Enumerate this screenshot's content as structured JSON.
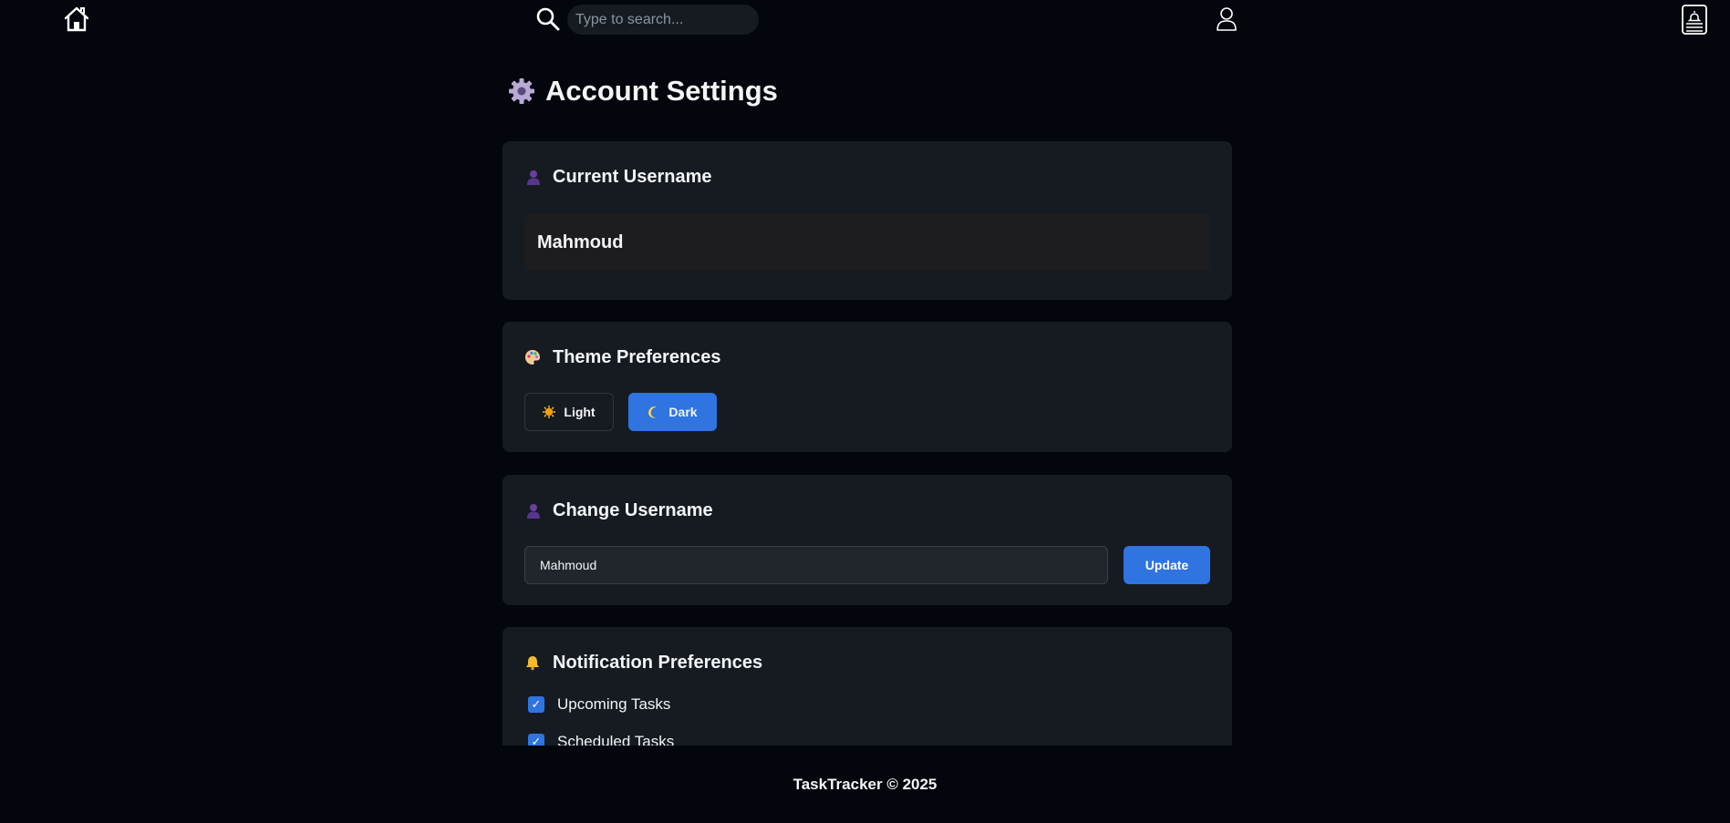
{
  "nav": {
    "search_placeholder": "Type to search..."
  },
  "page": {
    "title": "Account Settings"
  },
  "current_username": {
    "title": "Current Username",
    "value": "Mahmoud"
  },
  "theme": {
    "title": "Theme Preferences",
    "options": [
      {
        "label": "Light",
        "icon": "sun-icon",
        "selected": false
      },
      {
        "label": "Dark",
        "icon": "moon-icon",
        "selected": true
      }
    ]
  },
  "change_username": {
    "title": "Change Username",
    "input_value": "Mahmoud",
    "button_label": "Update"
  },
  "notifications": {
    "title": "Notification Preferences",
    "items": [
      {
        "label": "Upcoming Tasks",
        "checked": true
      },
      {
        "label": "Scheduled Tasks",
        "checked": true
      }
    ]
  },
  "footer": {
    "text": "TaskTracker © 2025"
  },
  "colors": {
    "background": "#03060c",
    "card": "#161b22",
    "accent": "#2f74e0",
    "username_box": "#1d1d1f"
  }
}
